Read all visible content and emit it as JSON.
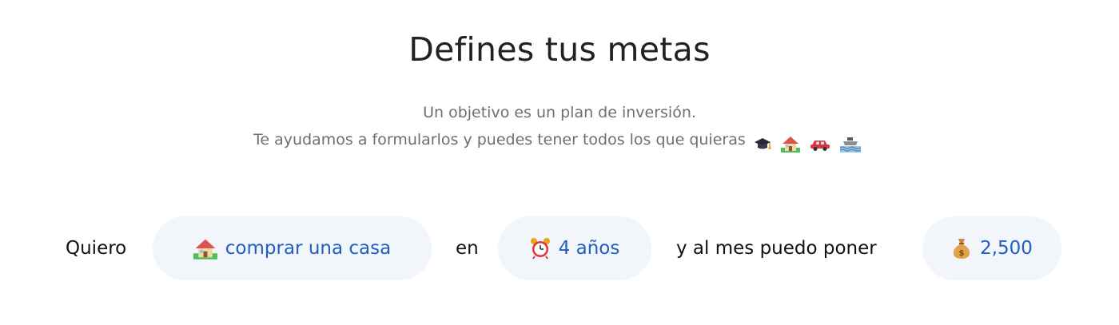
{
  "header": {
    "title": "Defines tus metas",
    "subtitle_line1": "Un objetivo es un plan de inversión.",
    "subtitle_line2": "Te ayudamos a formularlos y puedes tener todos los que quieras",
    "emoji_icons": [
      "graduation-cap-icon",
      "house-icon",
      "car-icon",
      "boat-icon"
    ]
  },
  "goal_sentence": {
    "prefix": "Quiero",
    "goal": {
      "icon": "house-icon",
      "value": "comprar una casa"
    },
    "connector": "en",
    "time": {
      "icon": "alarm-clock-icon",
      "value": "4 años"
    },
    "middle": "y al mes puedo poner",
    "amount": {
      "icon": "money-bag-icon",
      "value": "2,500"
    }
  },
  "colors": {
    "pill_background": "#f2f5f9",
    "pill_text": "#1f5fbf",
    "title_text": "#222222",
    "subtitle_text": "#6f6f6f"
  }
}
